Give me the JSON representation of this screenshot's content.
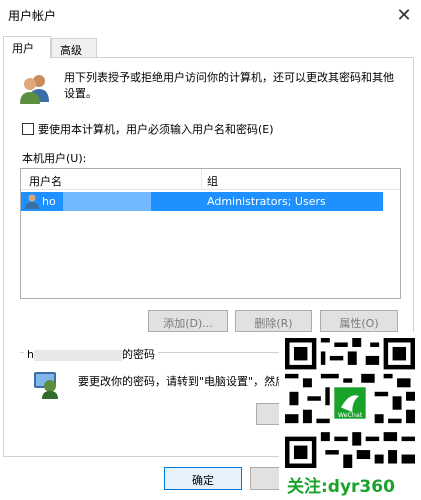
{
  "window": {
    "title": "用户帐户",
    "close_glyph": "✕"
  },
  "tabs": [
    {
      "label": "用户",
      "active": true
    },
    {
      "label": "高级",
      "active": false
    }
  ],
  "intro": {
    "text": "用下列表授予或拒绝用户访问你的计算机，还可以更改其密码和其他设置。",
    "icon": "users-icon"
  },
  "require_login": {
    "label": "要使用本计算机，用户必须输入用户名和密码(E)",
    "checked": false
  },
  "local_users": {
    "label": "本机用户(U):",
    "columns": [
      "用户名",
      "组"
    ],
    "rows": [
      {
        "name": "ho",
        "group": "Administrators; Users",
        "selected": true
      }
    ]
  },
  "buttons": {
    "add": "添加(D)...",
    "delete": "删除(R)",
    "properties": "属性(O)"
  },
  "password_box": {
    "title_prefix": "h",
    "title_suffix": "的密码",
    "text": "要更改你的密码，请转到\"电脑设置\"，然后",
    "icon": "key-icon"
  },
  "footer": {
    "ok": "确定"
  },
  "watermark": {
    "text": "关注:dyr360",
    "qr_label": "WeChat",
    "color": "#1aa32b"
  }
}
